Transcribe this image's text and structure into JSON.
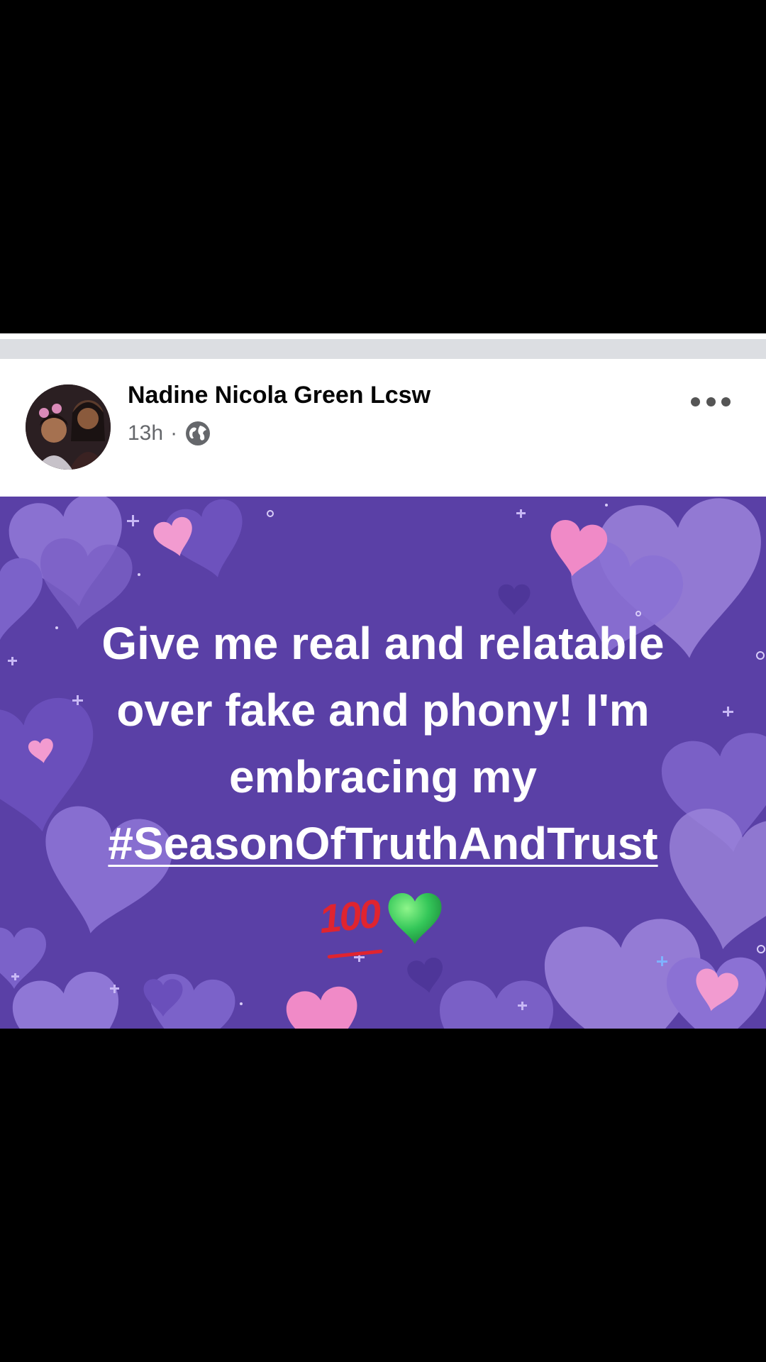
{
  "post": {
    "author_name": "Nadine Nicola Green Lcsw",
    "time_ago": "13h",
    "separator_dot": "·",
    "privacy_icon": "globe-icon",
    "more_icon": "more-horizontal-icon",
    "text_lines": [
      "Give me real and relatable",
      "over fake and phony! I'm",
      "embracing my"
    ],
    "hashtag": "#SeasonOfTruthAndTrust",
    "emojis": {
      "hundred": "100",
      "heart": "green-heart-emoji"
    }
  },
  "colors": {
    "post_background": "#5a40a6",
    "heart_light": "#9c84db",
    "heart_pink": "#f29bd0",
    "text": "#ffffff"
  }
}
